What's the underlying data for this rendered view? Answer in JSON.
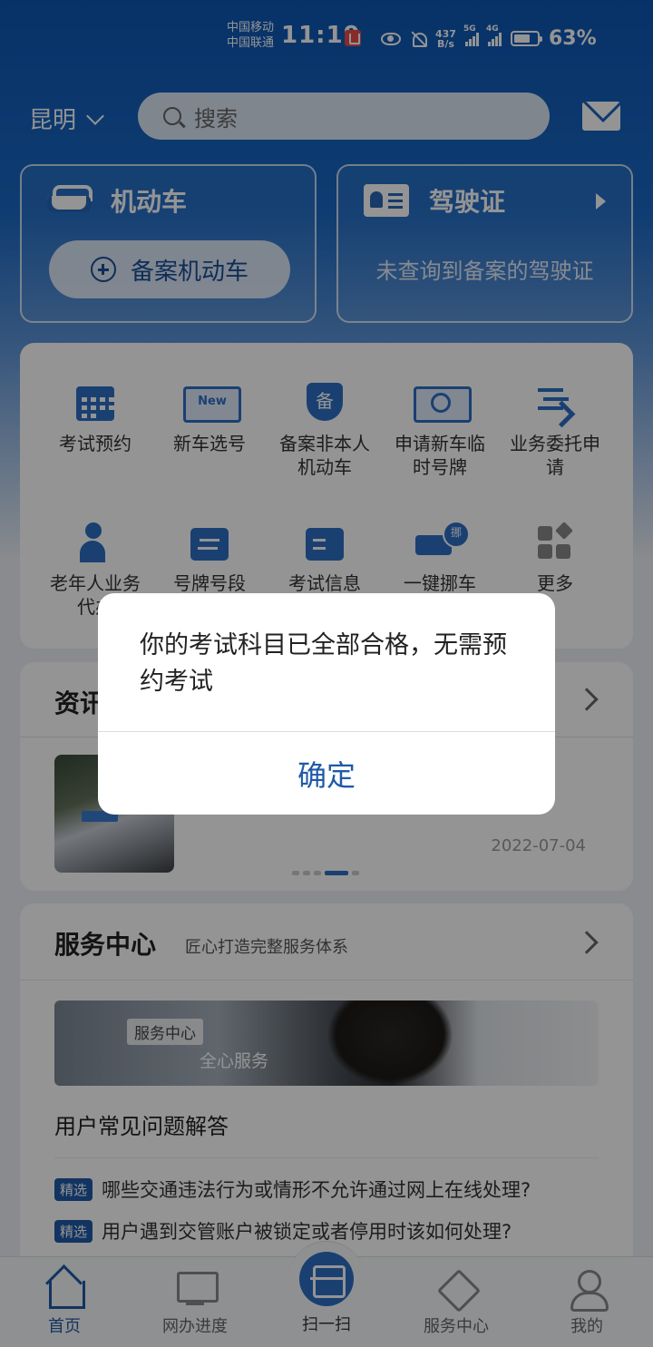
{
  "status_bar": {
    "carrier_1": "中国移动",
    "carrier_2": "中国联通",
    "time": "11:19",
    "net_speed": "437",
    "net_speed_unit": "B/s",
    "signal_1": "5G",
    "signal_2": "4G",
    "battery": "63%"
  },
  "header": {
    "city": "昆明",
    "search_placeholder": "搜索"
  },
  "vehicle_card": {
    "title": "机动车",
    "add_button": "备案机动车"
  },
  "license_card": {
    "title": "驾驶证",
    "status": "未查询到备案的驾驶证"
  },
  "services": [
    {
      "label": "考试预约",
      "icon": "calendar-icon"
    },
    {
      "label": "新车选号",
      "icon": "new-plate-icon"
    },
    {
      "label": "备案非本人机动车",
      "icon": "shield-icon"
    },
    {
      "label": "申请新车临时号牌",
      "icon": "temp-plate-icon"
    },
    {
      "label": "业务委托申请",
      "icon": "delegate-icon"
    },
    {
      "label": "老年人业务代办",
      "icon": "elderly-icon"
    },
    {
      "label": "号牌号段",
      "icon": "plate-segment-icon"
    },
    {
      "label": "考试信息",
      "icon": "exam-info-icon"
    },
    {
      "label": "一键挪车",
      "icon": "tow-car-icon"
    },
    {
      "label": "更多",
      "icon": "more-icon"
    }
  ],
  "news": {
    "title": "资讯",
    "date": "2022-07-04"
  },
  "service_center": {
    "title": "服务中心",
    "subtitle": "匠心打造完整服务体系",
    "banner_tag": "服务中心",
    "banner_text": "全心服务",
    "faq_title": "用户常见问题解答",
    "faq_tag": "精选",
    "faq_items": [
      "哪些交通违法行为或情形不允许通过网上在线处理?",
      "用户遇到交管账户被锁定或者停用时该如何处理?"
    ]
  },
  "bottom_nav": {
    "home": "首页",
    "progress": "网办进度",
    "scan": "扫一扫",
    "service": "服务中心",
    "mine": "我的"
  },
  "dialog": {
    "message": "你的考试科目已全部合格，无需预约考试",
    "ok": "确定"
  }
}
